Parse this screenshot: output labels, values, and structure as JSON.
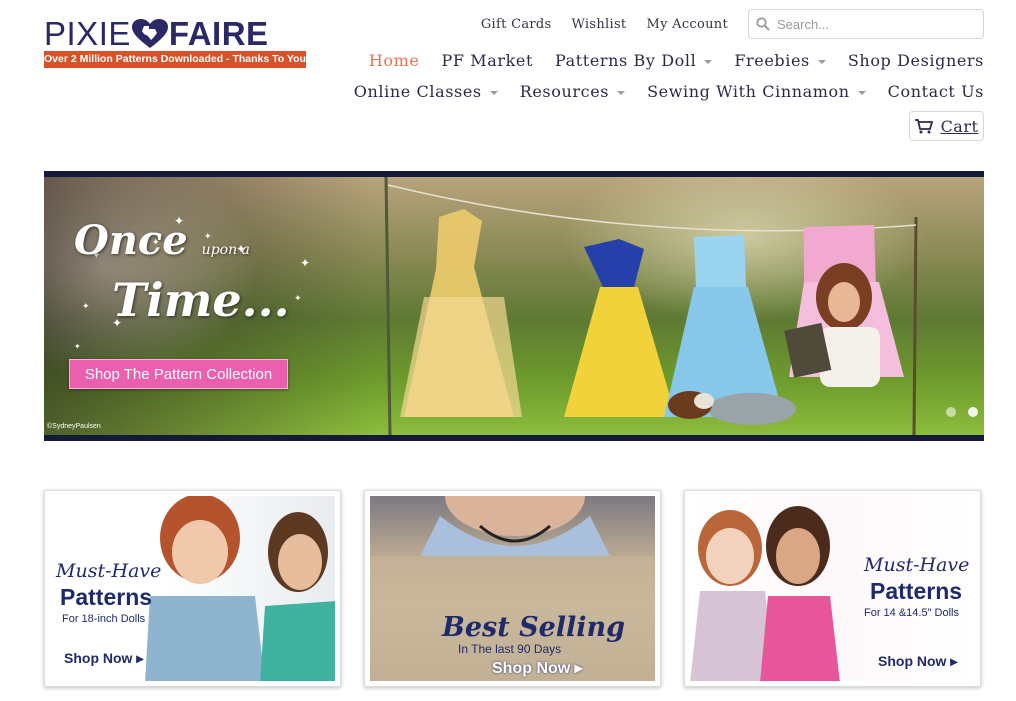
{
  "brand": {
    "name_left": "PIXIE",
    "name_right": "FAIRE",
    "tagline": "Over 2 Million Patterns Downloaded - Thanks To You!",
    "colors": {
      "navy": "#2a2966",
      "orange": "#d6532a",
      "accent": "#e8735a"
    }
  },
  "utility_nav": {
    "items": [
      {
        "label": "Gift Cards"
      },
      {
        "label": "Wishlist"
      },
      {
        "label": "My Account"
      }
    ],
    "search": {
      "placeholder": "Search...",
      "icon": "search-icon"
    }
  },
  "main_nav": {
    "row1": [
      {
        "label": "Home",
        "active": true
      },
      {
        "label": "PF Market"
      },
      {
        "label": "Patterns By Doll",
        "dropdown": true
      },
      {
        "label": "Freebies",
        "dropdown": true
      },
      {
        "label": "Shop Designers"
      }
    ],
    "row2": [
      {
        "label": "Online Classes",
        "dropdown": true
      },
      {
        "label": "Resources",
        "dropdown": true
      },
      {
        "label": "Sewing With Cinnamon",
        "dropdown": true
      },
      {
        "label": "Contact Us"
      }
    ]
  },
  "cart": {
    "label": "Cart",
    "icon": "cart-icon"
  },
  "hero": {
    "title_line1": "Once",
    "title_small": "upon a",
    "title_line2": "Time...",
    "button_label": "Shop The Pattern Collection",
    "credit": "©SydneyPaulsen",
    "dots": 2,
    "active_dot": 1
  },
  "tiles": [
    {
      "kind": "promo",
      "script": "Must-Have",
      "big": "Patterns",
      "small": "For 18-inch Dolls",
      "cta": "Shop Now"
    },
    {
      "kind": "promo",
      "script": "Best Selling",
      "small": "In The last 90 Days",
      "cta": "Shop Now"
    },
    {
      "kind": "promo",
      "script": "Must-Have",
      "big": "Patterns",
      "small": "For 14 &14.5\" Dolls",
      "cta": "Shop Now"
    }
  ]
}
